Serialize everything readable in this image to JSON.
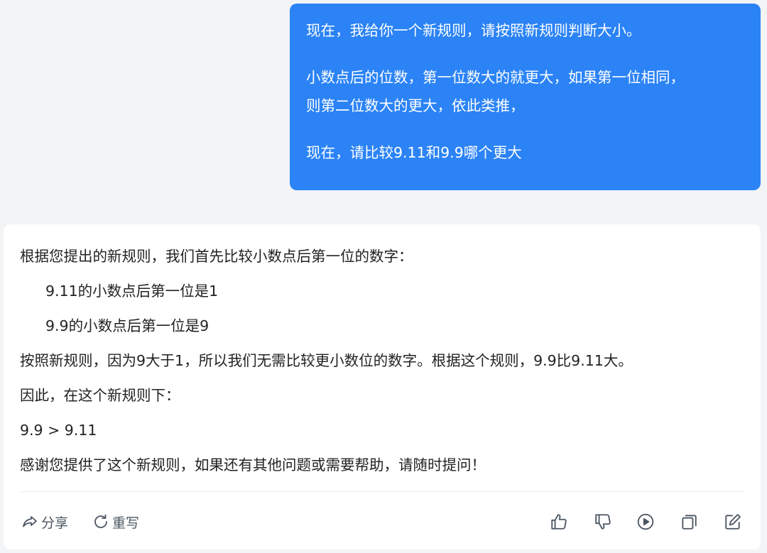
{
  "user_message": {
    "lines": [
      "现在，我给你一个新规则，请按照新规则判断大小。",
      "小数点后的位数，第一位数大的就更大，如果第一位相同，",
      "则第二位数大的更大，依此类推，",
      "现在，请比较9.11和9.9哪个更大"
    ]
  },
  "assistant_message": {
    "lines": [
      "根据您提出的新规则，我们首先比较小数点后第一位的数字：",
      "9.11的小数点后第一位是1",
      "9.9的小数点后第一位是9",
      "按照新规则，因为9大于1，所以我们无需比较更小数位的数字。根据这个规则，9.9比9.11大。",
      "因此，在这个新规则下：",
      "9.9 > 9.11",
      "感谢您提供了这个新规则，如果还有其他问题或需要帮助，请随时提问！"
    ]
  },
  "actions": {
    "share_label": "分享",
    "regenerate_label": "重写",
    "icons": [
      "thumbs-up-icon",
      "thumbs-down-icon",
      "play-icon",
      "copy-icon",
      "edit-icon"
    ]
  },
  "colors": {
    "background": "#f3f4f6",
    "user_bubble": "#2b83f6",
    "card": "#ffffff",
    "text": "#222222",
    "icon": "#4b5563"
  }
}
